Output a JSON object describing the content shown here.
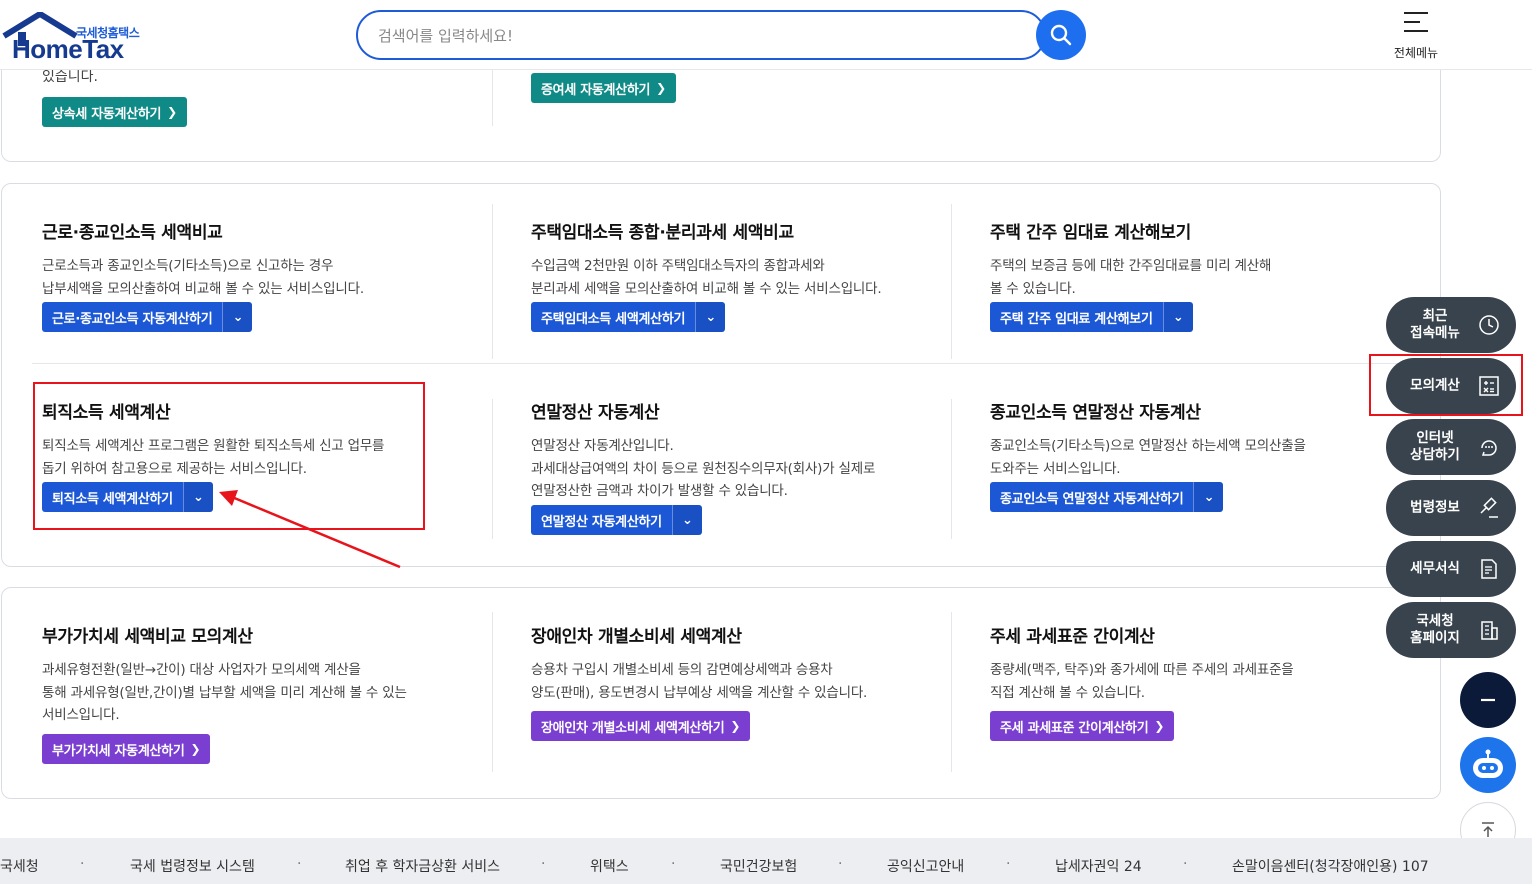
{
  "header": {
    "logo_small": "국세청홈택스",
    "logo_main": "HomeTax",
    "search_placeholder": "검색어를 입력하세요!",
    "menu_label": "전체메뉴"
  },
  "top_card": {
    "fragment_text": "있습니다.",
    "btn_inheritance": "상속세 자동계산하기",
    "btn_gift": "증여세 자동계산하기"
  },
  "card2": [
    {
      "title": "근로·종교인소득 세액비교",
      "desc": [
        "근로소득과 종교인소득(기타소득)으로 신고하는 경우",
        "납부세액을 모의산출하여 비교해 볼 수 있는 서비스입니다."
      ],
      "button": "근로·종교인소득 자동계산하기"
    },
    {
      "title": "주택임대소득 종합·분리과세 세액비교",
      "desc": [
        "수입금액 2천만원 이하 주택임대소득자의 종합과세와",
        "분리과세 세액을 모의산출하여 비교해 볼 수 있는 서비스입니다."
      ],
      "button": "주택임대소득 세액계산하기"
    },
    {
      "title": "주택 간주 임대료 계산해보기",
      "desc": [
        "주택의 보증금 등에 대한 간주임대료를 미리 계산해",
        "볼 수 있습니다."
      ],
      "button": "주택 간주 임대료 계산해보기"
    },
    {
      "title": "퇴직소득 세액계산",
      "desc": [
        "퇴직소득 세액계산 프로그램은 원활한 퇴직소득세 신고 업무를",
        "돕기 위하여 참고용으로 제공하는 서비스입니다."
      ],
      "button": "퇴직소득 세액계산하기"
    },
    {
      "title": "연말정산 자동계산",
      "desc": [
        "연말정산 자동계산입니다.",
        "과세대상급여액의 차이 등으로 원천징수의무자(회사)가 실제로",
        "연말정산한 금액과 차이가 발생할 수 있습니다."
      ],
      "button": "연말정산 자동계산하기"
    },
    {
      "title": "종교인소득 연말정산 자동계산",
      "desc": [
        "종교인소득(기타소득)으로 연말정산 하는세액 모의산출을",
        "도와주는 서비스입니다."
      ],
      "button": "종교인소득 연말정산 자동계산하기"
    }
  ],
  "card3": [
    {
      "title": "부가가치세 세액비교 모의계산",
      "desc": [
        "과세유형전환(일반→간이) 대상 사업자가 모의세액 계산을",
        "통해 과세유형(일반,간이)별 납부할 세액을 미리 계산해 볼 수 있는",
        "서비스입니다."
      ],
      "button": "부가가치세 자동계산하기"
    },
    {
      "title": "장애인차 개별소비세 세액계산",
      "desc": [
        "승용차 구입시 개별소비세 등의 감면예상세액과 승용차",
        "양도(판매), 용도변경시 납부예상 세액을 계산할 수 있습니다."
      ],
      "button": "장애인차 개별소비세 세액계산하기"
    },
    {
      "title": "주세 과세표준 간이계산",
      "desc": [
        "종량세(맥주, 탁주)와 종가세에 따른 주세의 과세표준을",
        "직접 계산해 볼 수 있습니다."
      ],
      "button": "주세 과세표준 간이계산하기"
    }
  ],
  "quick_menu": [
    {
      "label": "최근\n접속메뉴",
      "icon": "clock-icon"
    },
    {
      "label": "모의계산",
      "icon": "calculator-icon"
    },
    {
      "label": "인터넷\n상담하기",
      "icon": "chat-icon"
    },
    {
      "label": "법령정보",
      "icon": "gavel-icon"
    },
    {
      "label": "세무서식",
      "icon": "document-icon"
    },
    {
      "label": "국세청\n홈페이지",
      "icon": "building-icon"
    }
  ],
  "footer_links": [
    "국세청",
    "국세 법령정보 시스템",
    "취업 후 학자금상환 서비스",
    "위택스",
    "국민건강보험",
    "공익신고안내",
    "납세자권익 24",
    "손말이음센터(청각장애인용) 107"
  ],
  "colors": {
    "teal": "#0f8a86",
    "blue": "#1c58d5",
    "purple": "#7a3ed0",
    "annotation_red": "#e8141b",
    "fab_dark": "#39434d"
  }
}
